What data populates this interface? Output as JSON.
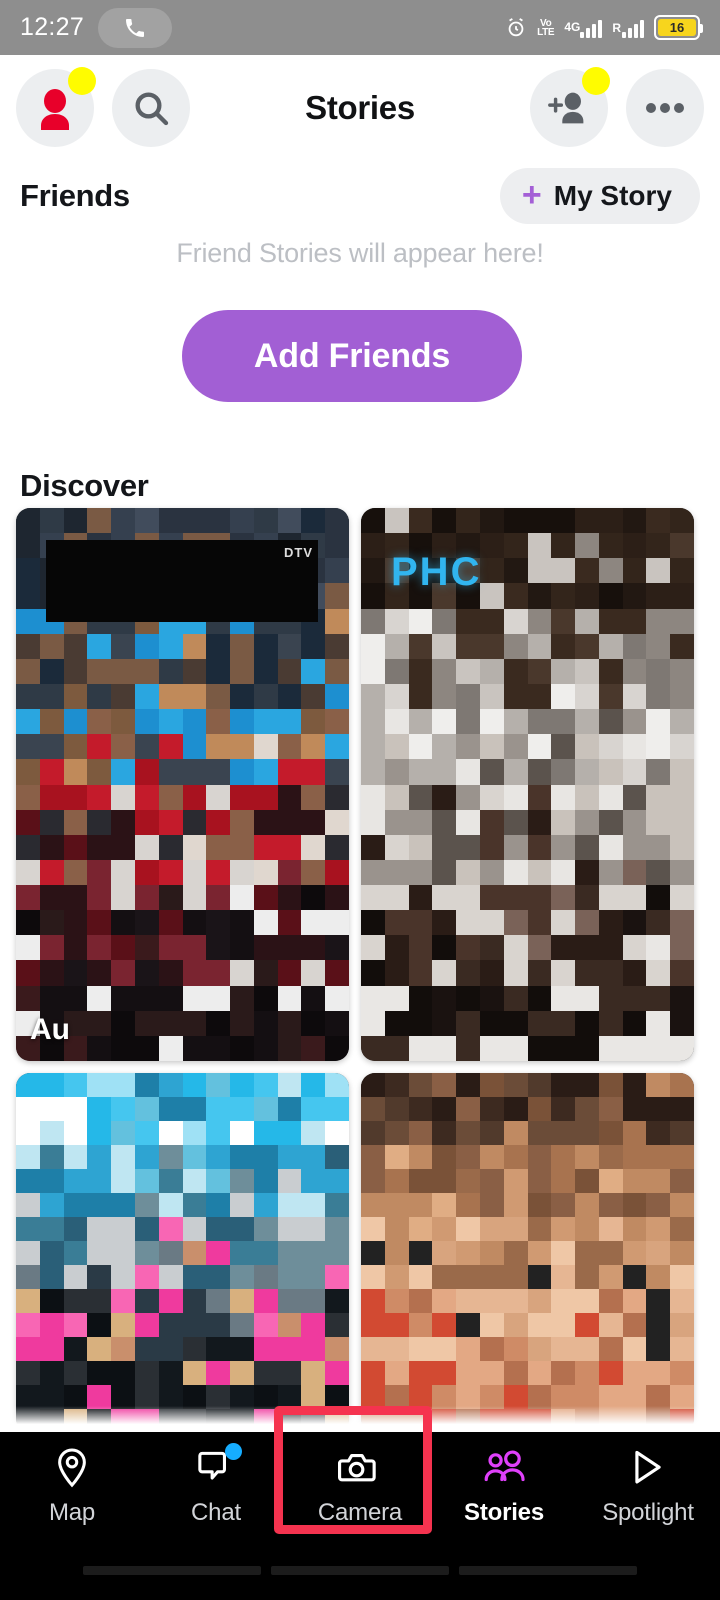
{
  "status_bar": {
    "time": "12:27",
    "phone_icon": "phone-icon",
    "alarm_icon": "alarm-icon",
    "volte_line1": "Vo",
    "volte_line2": "LTE",
    "network": "4G",
    "roaming": "R",
    "battery_percent": "16"
  },
  "header": {
    "title": "Stories",
    "profile_icon": "profile-avatar-icon",
    "search_icon": "search-icon",
    "add_friend_icon": "add-friend-icon",
    "more_icon": "more-options-icon"
  },
  "friends": {
    "section_title": "Friends",
    "my_story_label": "My Story",
    "my_story_plus": "+",
    "empty_message": "Friend Stories will appear here!",
    "add_friends_label": "Add Friends"
  },
  "discover": {
    "section_title": "Discover",
    "tiles": [
      {
        "label": "Au",
        "brand": "DTV",
        "brand_pos": "banner"
      },
      {
        "label": "",
        "brand": "PHC",
        "brand_pos": "phc"
      },
      {
        "label": "",
        "brand": "",
        "brand_pos": ""
      },
      {
        "label": "",
        "brand": "",
        "brand_pos": ""
      }
    ]
  },
  "bottom_nav": {
    "items": [
      {
        "label": "Map",
        "icon": "map-pin-icon",
        "active": false,
        "badge": false
      },
      {
        "label": "Chat",
        "icon": "chat-bubble-icon",
        "active": false,
        "badge": true
      },
      {
        "label": "Camera",
        "icon": "camera-icon",
        "active": false,
        "badge": false
      },
      {
        "label": "Stories",
        "icon": "stories-people-icon",
        "active": true,
        "badge": false
      },
      {
        "label": "Spotlight",
        "icon": "spotlight-play-icon",
        "active": false,
        "badge": false
      }
    ]
  },
  "annotation": {
    "target": "Camera",
    "color": "#f5334f"
  },
  "colors": {
    "accent_purple": "#a25fd4",
    "snap_yellow": "#fffc00",
    "stories_magenta": "#e040fb",
    "chat_badge_blue": "#16adff",
    "nav_background": "#000000",
    "statusbar_gray": "#8e8e8e"
  }
}
